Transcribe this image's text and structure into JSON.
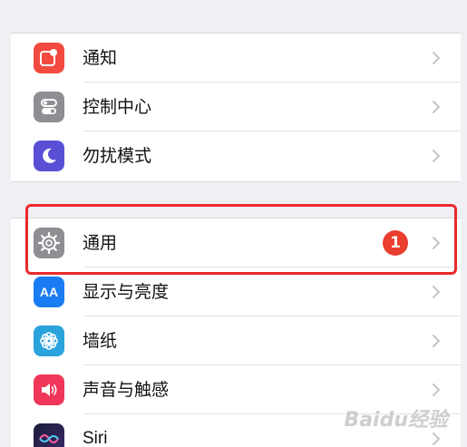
{
  "settings": {
    "group1": [
      {
        "label": "通知",
        "icon": "notifications-icon",
        "color": "#f24a3f"
      },
      {
        "label": "控制中心",
        "icon": "control-center-icon",
        "color": "#8e8e93"
      },
      {
        "label": "勿扰模式",
        "icon": "moon-icon",
        "color": "#5a50d6"
      }
    ],
    "group2": [
      {
        "label": "通用",
        "icon": "gear-icon",
        "color": "#8e8e93",
        "badge": "1"
      },
      {
        "label": "显示与亮度",
        "icon": "display-icon",
        "color": "#1a7cf2",
        "icon_text": "AA"
      },
      {
        "label": "墙纸",
        "icon": "wallpaper-icon",
        "color": "#2aa3dc"
      },
      {
        "label": "声音与触感",
        "icon": "sound-icon",
        "color": "#f0375a"
      },
      {
        "label": "Siri",
        "icon": "siri-icon",
        "color": "#222"
      }
    ]
  },
  "watermark": "Baidu经验",
  "colors": {
    "highlight": "#ea2a2a",
    "badge": "#ea3e2f",
    "background": "#efeff4"
  }
}
